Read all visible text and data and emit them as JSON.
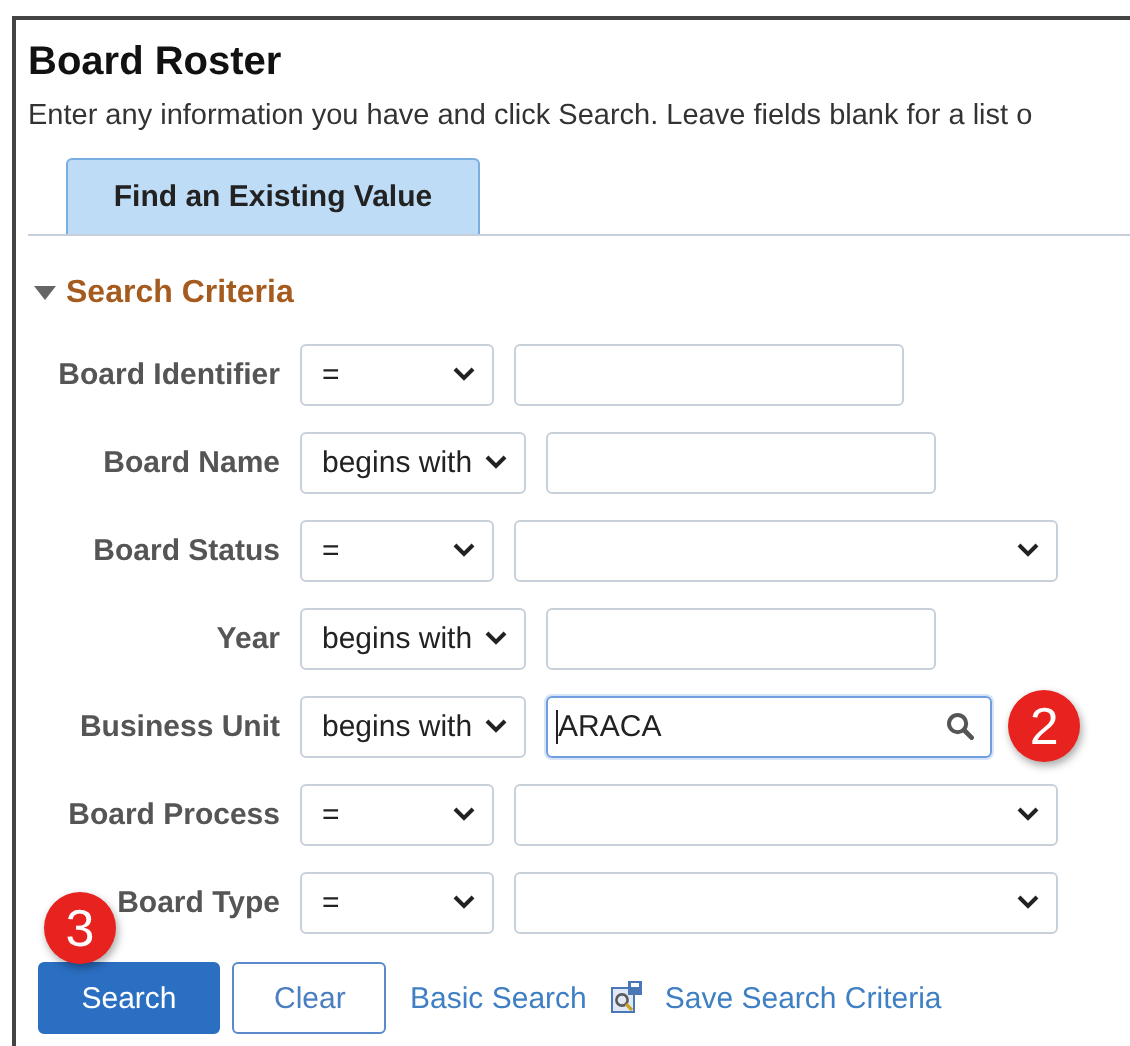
{
  "page": {
    "title": "Board Roster",
    "instructions": "Enter any information you have and click Search. Leave fields blank for a list o"
  },
  "tabs": [
    {
      "label": "Find an Existing Value",
      "selected": true
    }
  ],
  "section": {
    "title": "Search Criteria",
    "expanded": true
  },
  "criteria": [
    {
      "label": "Board Identifier",
      "operator": "=",
      "kind": "text"
    },
    {
      "label": "Board Name",
      "operator": "begins with",
      "kind": "text"
    },
    {
      "label": "Board Status",
      "operator": "=",
      "kind": "select"
    },
    {
      "label": "Year",
      "operator": "begins with",
      "kind": "text"
    },
    {
      "label": "Business Unit",
      "operator": "begins with",
      "kind": "lookup",
      "value": "ARACA",
      "focused": true,
      "callout": "2"
    },
    {
      "label": "Board Process",
      "operator": "=",
      "kind": "select"
    },
    {
      "label": "Board Type",
      "operator": "=",
      "kind": "select"
    }
  ],
  "buttons": [
    {
      "label": "Search",
      "kind": "primary",
      "callout": "3"
    },
    {
      "label": "Clear",
      "kind": "secondary"
    }
  ],
  "links": [
    {
      "label": "Basic Search",
      "kind": "plain"
    },
    {
      "label": "Save Search Criteria",
      "kind": "icon"
    }
  ]
}
